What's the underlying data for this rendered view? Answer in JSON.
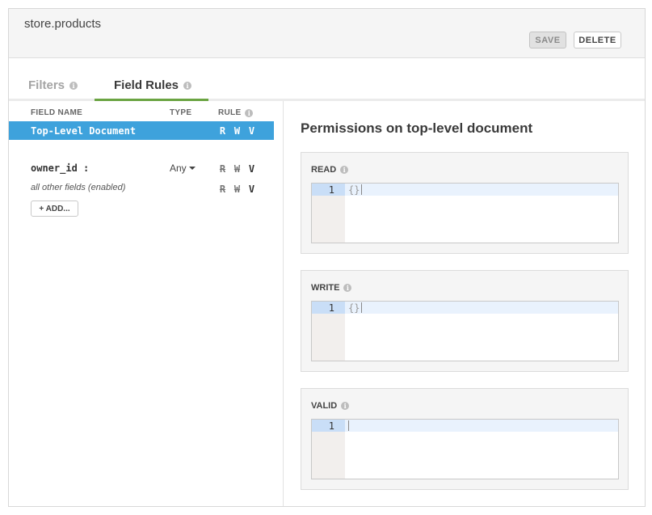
{
  "header": {
    "collection": "store.products",
    "save_label": "SAVE",
    "delete_label": "DELETE"
  },
  "tabs": [
    {
      "label": "Filters",
      "active": false
    },
    {
      "label": "Field Rules",
      "active": true
    }
  ],
  "field_table": {
    "columns": [
      "FIELD NAME",
      "TYPE",
      "RULE"
    ],
    "rows": [
      {
        "name": "Top-Level Document",
        "type": "",
        "rules": [
          "R",
          "W",
          "V"
        ],
        "selected": true,
        "disabled_rules": []
      },
      {
        "name": "owner_id :",
        "type": "Any",
        "rules": [
          "R",
          "W",
          "V"
        ],
        "selected": false,
        "disabled_rules": [
          "R",
          "W"
        ]
      },
      {
        "name": "all other fields (enabled)",
        "type": "",
        "rules": [
          "R",
          "W",
          "V"
        ],
        "selected": false,
        "disabled_rules": [
          "R",
          "W"
        ]
      }
    ],
    "add_label": "+ ADD..."
  },
  "permissions": {
    "title": "Permissions on top-level document",
    "sections": [
      {
        "label": "READ",
        "line": "1",
        "code": "{}"
      },
      {
        "label": "WRITE",
        "line": "1",
        "code": "{}"
      },
      {
        "label": "VALID",
        "line": "1",
        "code": ""
      }
    ]
  },
  "colors": {
    "selected_row": "#3ea2dc",
    "active_tab_underline": "#6ba442"
  }
}
